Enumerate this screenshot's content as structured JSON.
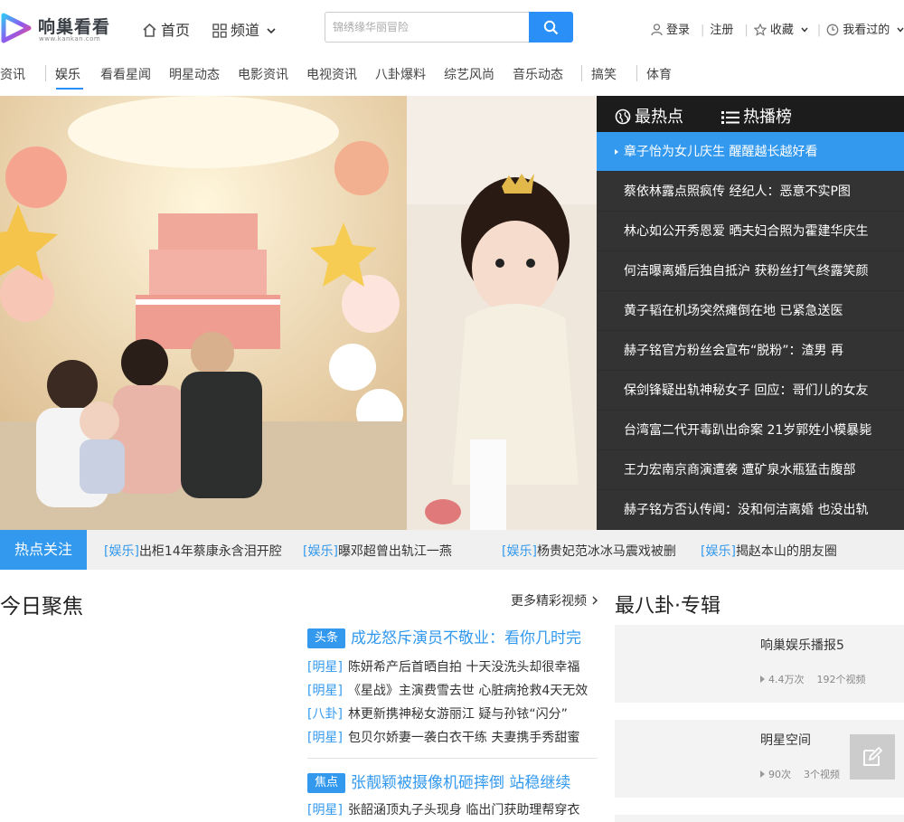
{
  "header": {
    "logo_text": "响巢看看",
    "logo_sub": "www.kankan.com",
    "home_label": "首页",
    "channel_label": "频道",
    "search_placeholder": "锦绣缘华丽冒险",
    "login_label": "登录",
    "register_label": "注册",
    "favorites_label": "收藏",
    "history_label": "我看过的"
  },
  "subnav": {
    "items": [
      "资讯",
      "娱乐",
      "看看星闻",
      "明星动态",
      "电影资讯",
      "电视资讯",
      "八卦爆料",
      "综艺风尚",
      "音乐动态",
      "搞笑",
      "体育"
    ],
    "active": "娱乐"
  },
  "hot": {
    "tab_hot": "最热点",
    "tab_rank": "热播榜",
    "items": [
      "章子怡为女儿庆生  醒醒越长越好看",
      "蔡依林露点照疯传  经纪人：恶意不实P图",
      "林心如公开秀恩爱  晒夫妇合照为霍建华庆生",
      "何洁曝离婚后独自抵沪  获粉丝打气终露笑颜",
      "黄子韬在机场突然瘫倒在地  已紧急送医",
      "赫子铭官方粉丝会宣布“脱粉”：渣男  再",
      "保剑锋疑出轨神秘女子  回应：哥们儿的女友",
      "台湾富二代开毒趴出命案  21岁郭姓小模暴毙",
      "王力宏南京商演遭袭  遭矿泉水瓶猛击腹部",
      "赫子铭方否认传闻：没和何洁离婚  也没出轨"
    ]
  },
  "ticker": {
    "label": "热点关注",
    "items": [
      {
        "tag": "[娱乐]",
        "text": "出柜14年蔡康永含泪开腔"
      },
      {
        "tag": "[娱乐]",
        "text": "曝邓超曾出轨江一燕"
      },
      {
        "tag": "[娱乐]",
        "text": "杨贵妃范冰冰马震戏被删"
      },
      {
        "tag": "[娱乐]",
        "text": "揭赵本山的朋友圈"
      }
    ]
  },
  "focus": {
    "title": "今日聚焦",
    "more": "更多精彩视频",
    "blocks": [
      {
        "badge": "头条",
        "headline": "成龙怒斥演员不敬业：看你几时完",
        "lines": [
          {
            "tag": "[明星]",
            "text": "陈妍希产后首晒自拍 十天没洗头却很幸福"
          },
          {
            "tag": "[明星]",
            "text": "《星战》主演费雪去世 心脏病抢救4天无效"
          },
          {
            "tag": "[八卦]",
            "text": "林更新携神秘女游丽江 疑与孙铱“闪分”"
          },
          {
            "tag": "[明星]",
            "text": "包贝尔娇妻一袭白衣干练 夫妻携手秀甜蜜"
          }
        ]
      },
      {
        "badge": "焦点",
        "headline": "张靓颖被摄像机砸摔倒 站稳继续",
        "lines": [
          {
            "tag": "[明星]",
            "text": "张韶涵顶丸子头现身 临出门获助理帮穿衣"
          }
        ]
      }
    ]
  },
  "gossip": {
    "title": "最八卦·专辑",
    "cards": [
      {
        "name": "响巢娱乐播报5",
        "plays": "4.4万次",
        "videos": "192个视频"
      },
      {
        "name": "明星空间",
        "plays": "90次",
        "videos": "3个视频"
      }
    ]
  },
  "colors": {
    "accent": "#3399ee",
    "panel_bg": "#333333"
  }
}
